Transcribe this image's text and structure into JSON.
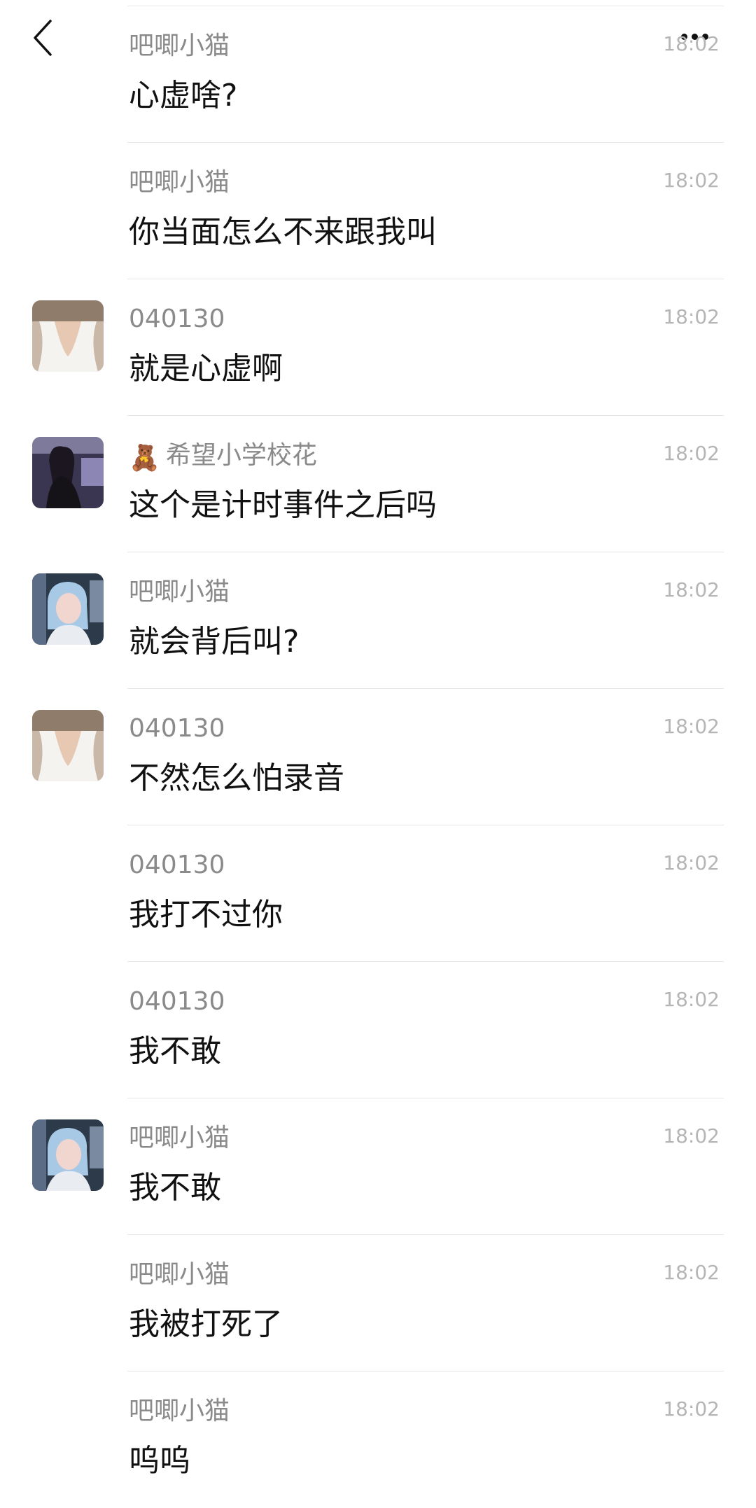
{
  "header": {
    "back_icon": "chevron-left-icon",
    "more_icon": "more-horizontal-icon"
  },
  "messages": [
    {
      "sender": "吧唧小猫",
      "time": "18:02",
      "text": "心虚啥?",
      "avatar": "none"
    },
    {
      "sender": "吧唧小猫",
      "time": "18:02",
      "text": "你当面怎么不来跟我叫",
      "avatar": "none"
    },
    {
      "sender": "040130",
      "time": "18:02",
      "text": "就是心虚啊",
      "avatar": "white-dress-photo"
    },
    {
      "sender": "希望小学校花",
      "sender_prefix": "🧸",
      "time": "18:02",
      "text": "这个是计时事件之后吗",
      "avatar": "dark-portrait-photo"
    },
    {
      "sender": "吧唧小猫",
      "time": "18:02",
      "text": "就会背后叫?",
      "avatar": "blue-hair-photo"
    },
    {
      "sender": "040130",
      "time": "18:02",
      "text": "不然怎么怕录音",
      "avatar": "white-dress-photo"
    },
    {
      "sender": "040130",
      "time": "18:02",
      "text": "我打不过你",
      "avatar": "none"
    },
    {
      "sender": "040130",
      "time": "18:02",
      "text": "我不敢",
      "avatar": "none"
    },
    {
      "sender": "吧唧小猫",
      "time": "18:02",
      "text": "我不敢",
      "avatar": "blue-hair-photo"
    },
    {
      "sender": "吧唧小猫",
      "time": "18:02",
      "text": "我被打死了",
      "avatar": "none"
    },
    {
      "sender": "吧唧小猫",
      "time": "18:02",
      "text": "呜呜",
      "avatar": "none"
    }
  ]
}
